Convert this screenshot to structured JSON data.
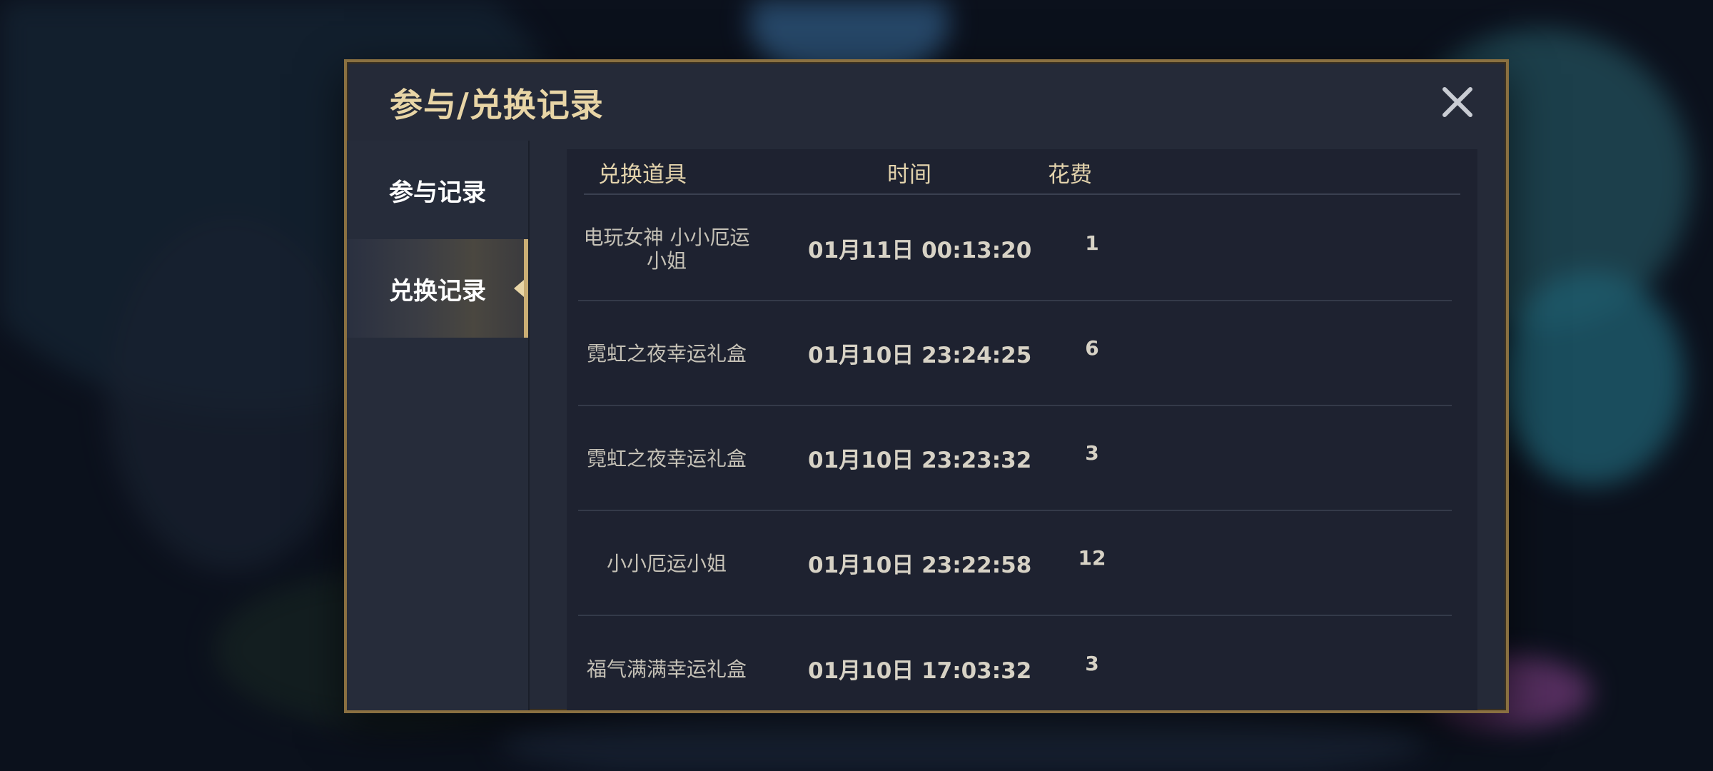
{
  "dialog": {
    "title": "参与/兑换记录",
    "close_icon": "close-icon"
  },
  "tabs": [
    {
      "label": "参与记录",
      "active": false
    },
    {
      "label": "兑换记录",
      "active": true
    }
  ],
  "table": {
    "headers": {
      "item": "兑换道具",
      "time": "时间",
      "cost": "花费"
    },
    "rows": [
      {
        "item": "电玩女神 小小厄运小姐",
        "time": "01月11日 00:13:20",
        "cost": "1"
      },
      {
        "item": "霓虹之夜幸运礼盒",
        "time": "01月10日 23:24:25",
        "cost": "6"
      },
      {
        "item": "霓虹之夜幸运礼盒",
        "time": "01月10日 23:23:32",
        "cost": "3"
      },
      {
        "item": "小小厄运小姐",
        "time": "01月10日 23:22:58",
        "cost": "12"
      },
      {
        "item": "福气满满幸运礼盒",
        "time": "01月10日 17:03:32",
        "cost": "3"
      }
    ]
  },
  "colors": {
    "accent_gold": "#c9ad74",
    "title_gold": "#e8d5a6",
    "dialog_bg": "#252a38",
    "table_bg": "#1e2230"
  }
}
